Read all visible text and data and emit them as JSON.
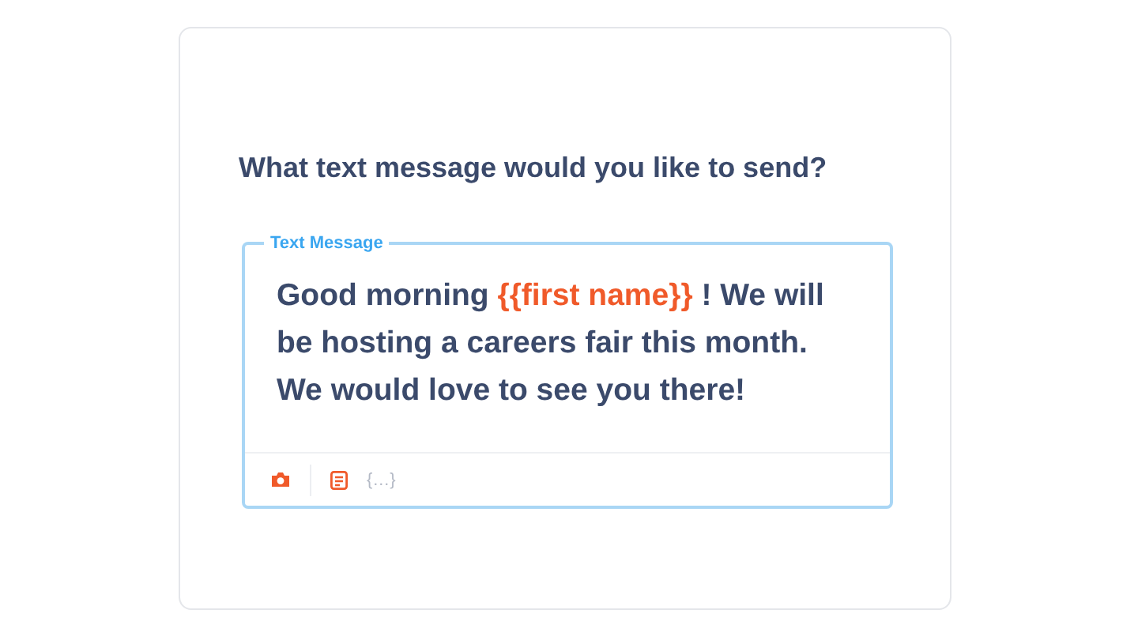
{
  "question": "What text message would you like to send?",
  "field": {
    "label": "Text Message",
    "message": [
      {
        "kind": "plain",
        "text": "Good morning "
      },
      {
        "kind": "variable",
        "text": "{{first name}}"
      },
      {
        "kind": "plain",
        "text": " ! We will be hosting a careers fair this month. We would love to see you there!"
      }
    ]
  },
  "toolbar": [
    {
      "kind": "camera",
      "disabled": false
    },
    {
      "kind": "divider"
    },
    {
      "kind": "template",
      "disabled": false
    },
    {
      "kind": "text",
      "text": "{…}",
      "disabled": true
    }
  ]
}
